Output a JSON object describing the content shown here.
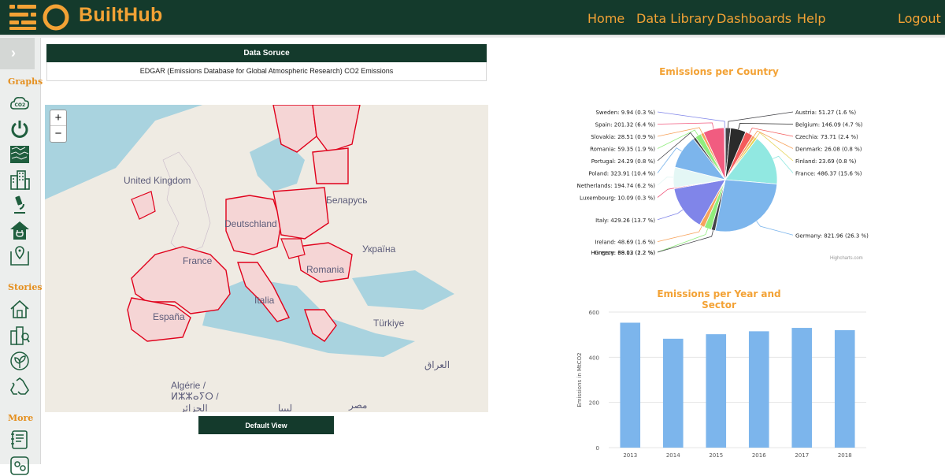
{
  "header": {
    "brand": "BuiltHub",
    "nav": [
      "Home",
      "Data Library",
      "Dashboards",
      "Help"
    ],
    "logout": "Logout",
    "accent": "#f3a235",
    "bg": "#143a2c"
  },
  "sidebar": {
    "toggle": "›",
    "sections": [
      {
        "title": "Graphs",
        "icons": [
          "co2-icon",
          "power-icon",
          "texture-icon",
          "buildings-icon",
          "microscope-icon",
          "house-plug-icon",
          "map-pin-icon"
        ]
      },
      {
        "title": "Stories",
        "icons": [
          "house-icon",
          "city-search-icon",
          "leaf-icon",
          "recycle-icon"
        ]
      },
      {
        "title": "More",
        "icons": [
          "notebook-icon",
          "settings-icon"
        ]
      }
    ]
  },
  "data_source": {
    "header": "Data Soruce",
    "value": "EDGAR (Emissions Database for Global Atmospheric Research) CO2 Emissions"
  },
  "map": {
    "zoom_in": "+",
    "zoom_out": "−",
    "labels": [
      "United Kingdom",
      "Deutschland",
      "Беларусь",
      "France",
      "Україна",
      "Romania",
      "Italia",
      "España",
      "Türkiye",
      "Algérie /",
      "ⵍⵣⵣⴰⵢⵔ /",
      "الجزائر",
      "العراق",
      "ليبيا",
      "مصر"
    ],
    "default_view": "Default View"
  },
  "pie_chart": {
    "chart_data": {
      "type": "pie",
      "title": "Emissions per Country",
      "slices": [
        {
          "name": "Austria",
          "value": 51.27,
          "pct": "1.6 %",
          "color": "#434348"
        },
        {
          "name": "Belgium",
          "value": 146.09,
          "pct": "4.7 %",
          "color": "#2b2b2b"
        },
        {
          "name": "Czechia",
          "value": 73.71,
          "pct": "2.4 %",
          "color": "#f45b5b"
        },
        {
          "name": "Denmark",
          "value": 26.08,
          "pct": "0.8 %",
          "color": "#f7a35c"
        },
        {
          "name": "Finland",
          "value": 23.69,
          "pct": "0.8 %",
          "color": "#e4d354"
        },
        {
          "name": "France",
          "value": 486.37,
          "pct": "15.6 %",
          "color": "#91e8e1"
        },
        {
          "name": "Germany",
          "value": 821.96,
          "pct": "26.3 %",
          "color": "#7cb5ec"
        },
        {
          "name": "Greece",
          "value": 38.02,
          "pct": "1.2 %",
          "color": "#434348"
        },
        {
          "name": "Hungary",
          "value": 69.13,
          "pct": "2.2 %",
          "color": "#90ed7d"
        },
        {
          "name": "Ireland",
          "value": 48.69,
          "pct": "1.6 %",
          "color": "#f7a35c"
        },
        {
          "name": "Italy",
          "value": 429.26,
          "pct": "13.7 %",
          "color": "#8085e9"
        },
        {
          "name": "Luxembourg",
          "value": 10.09,
          "pct": "0.3 %",
          "color": "#f15c80"
        },
        {
          "name": "Netherlands",
          "value": 194.74,
          "pct": "6.2 %",
          "color": "#e4f7f5"
        },
        {
          "name": "Poland",
          "value": 323.91,
          "pct": "10.4 %",
          "color": "#7cb5ec"
        },
        {
          "name": "Portugal",
          "value": 24.29,
          "pct": "0.8 %",
          "color": "#434348"
        },
        {
          "name": "Romania",
          "value": 59.35,
          "pct": "1.9 %",
          "color": "#90ed7d"
        },
        {
          "name": "Slovakia",
          "value": 28.51,
          "pct": "0.9 %",
          "color": "#f7a35c"
        },
        {
          "name": "Spain",
          "value": 201.32,
          "pct": "6.4 %",
          "color": "#f15c80"
        },
        {
          "name": "Sweden",
          "value": 9.94,
          "pct": "0.3 %",
          "color": "#8085e9"
        }
      ]
    },
    "credits": "Highcharts.com"
  },
  "bar_chart": {
    "chart_data": {
      "type": "bar",
      "title": "Emissions per Year and Sector",
      "categories": [
        "2013",
        "2014",
        "2015",
        "2016",
        "2017",
        "2018"
      ],
      "values": [
        553,
        482,
        502,
        515,
        530,
        520
      ],
      "ylabel": "Emissions in MtCO2",
      "ylim": [
        0,
        600
      ],
      "yticks": [
        0,
        200,
        400,
        600
      ],
      "grid": true,
      "color": "#7cb5ec"
    }
  }
}
